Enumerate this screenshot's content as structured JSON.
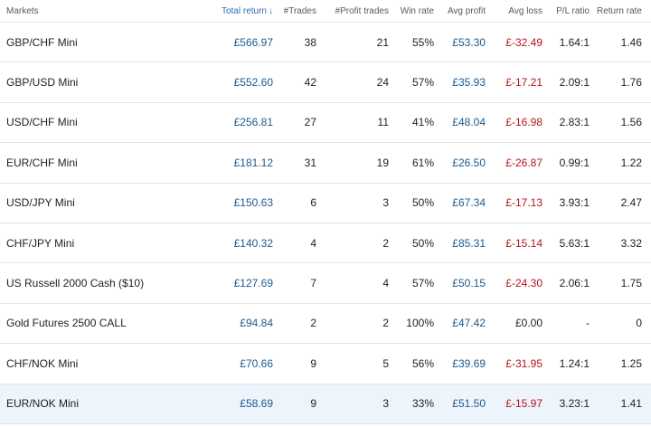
{
  "headers": {
    "market": "Markets",
    "total_return": "Total return",
    "trades": "#Trades",
    "profit_trades": "#Profit trades",
    "win_rate": "Win rate",
    "avg_profit": "Avg profit",
    "avg_loss": "Avg loss",
    "pl_ratio": "P/L ratio",
    "return_rate": "Return rate"
  },
  "sort": {
    "column": "total_return",
    "direction": "descending"
  },
  "colors": {
    "positive": "#1b5a8e",
    "negative": "#b3141b",
    "highlight_row": "#eef4fb",
    "sort_header": "#2f6fb0"
  },
  "rows": [
    {
      "market": "GBP/CHF Mini",
      "total_return": "£566.97",
      "trades": "38",
      "profit_trades": "21",
      "win_rate": "55%",
      "avg_profit": "£53.30",
      "avg_loss": "£-32.49",
      "pl_ratio": "1.64:1",
      "return_rate": "1.46"
    },
    {
      "market": "GBP/USD Mini",
      "total_return": "£552.60",
      "trades": "42",
      "profit_trades": "24",
      "win_rate": "57%",
      "avg_profit": "£35.93",
      "avg_loss": "£-17.21",
      "pl_ratio": "2.09:1",
      "return_rate": "1.76"
    },
    {
      "market": "USD/CHF Mini",
      "total_return": "£256.81",
      "trades": "27",
      "profit_trades": "11",
      "win_rate": "41%",
      "avg_profit": "£48.04",
      "avg_loss": "£-16.98",
      "pl_ratio": "2.83:1",
      "return_rate": "1.56"
    },
    {
      "market": "EUR/CHF Mini",
      "total_return": "£181.12",
      "trades": "31",
      "profit_trades": "19",
      "win_rate": "61%",
      "avg_profit": "£26.50",
      "avg_loss": "£-26.87",
      "pl_ratio": "0.99:1",
      "return_rate": "1.22"
    },
    {
      "market": "USD/JPY Mini",
      "total_return": "£150.63",
      "trades": "6",
      "profit_trades": "3",
      "win_rate": "50%",
      "avg_profit": "£67.34",
      "avg_loss": "£-17.13",
      "pl_ratio": "3.93:1",
      "return_rate": "2.47"
    },
    {
      "market": "CHF/JPY Mini",
      "total_return": "£140.32",
      "trades": "4",
      "profit_trades": "2",
      "win_rate": "50%",
      "avg_profit": "£85.31",
      "avg_loss": "£-15.14",
      "pl_ratio": "5.63:1",
      "return_rate": "3.32"
    },
    {
      "market": "US Russell 2000 Cash ($10)",
      "total_return": "£127.69",
      "trades": "7",
      "profit_trades": "4",
      "win_rate": "57%",
      "avg_profit": "£50.15",
      "avg_loss": "£-24.30",
      "pl_ratio": "2.06:1",
      "return_rate": "1.75"
    },
    {
      "market": "Gold Futures 2500 CALL",
      "total_return": "£94.84",
      "trades": "2",
      "profit_trades": "2",
      "win_rate": "100%",
      "avg_profit": "£47.42",
      "avg_loss": "£0.00",
      "pl_ratio": "-",
      "return_rate": "0"
    },
    {
      "market": "CHF/NOK Mini",
      "total_return": "£70.66",
      "trades": "9",
      "profit_trades": "5",
      "win_rate": "56%",
      "avg_profit": "£39.69",
      "avg_loss": "£-31.95",
      "pl_ratio": "1.24:1",
      "return_rate": "1.25"
    },
    {
      "market": "EUR/NOK Mini",
      "total_return": "£58.69",
      "trades": "9",
      "profit_trades": "3",
      "win_rate": "33%",
      "avg_profit": "£51.50",
      "avg_loss": "£-15.97",
      "pl_ratio": "3.23:1",
      "return_rate": "1.41",
      "highlighted": true
    }
  ]
}
